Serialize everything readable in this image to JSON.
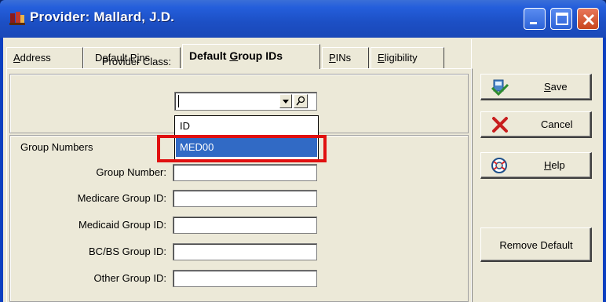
{
  "window": {
    "title": "Provider: Mallard, J.D."
  },
  "tabs": [
    {
      "label": "Address",
      "mnemonic": "A",
      "rest": "ddress"
    },
    {
      "label": "Default Pins",
      "pre": "Default P",
      "mnemonic": "i",
      "rest": "ns"
    },
    {
      "label": "Default Group IDs",
      "pre": "Default ",
      "mnemonic": "G",
      "rest": "roup IDs"
    },
    {
      "label": "PINs",
      "mnemonic": "P",
      "rest": "INs"
    },
    {
      "label": "Eligibility",
      "mnemonic": "E",
      "rest": "ligibility"
    }
  ],
  "provider_class": {
    "label": "Provider Class:",
    "value": ""
  },
  "dropdown": {
    "options": [
      "ID",
      "MED00"
    ],
    "selected": "MED00"
  },
  "group_numbers": {
    "heading": "Group Numbers",
    "fields": [
      {
        "label": "Group Number:",
        "value": ""
      },
      {
        "label": "Medicare Group ID:",
        "value": ""
      },
      {
        "label": "Medicaid Group ID:",
        "value": ""
      },
      {
        "label": "BC/BS Group ID:",
        "value": ""
      },
      {
        "label": "Other Group ID:",
        "value": ""
      }
    ]
  },
  "buttons": {
    "save": {
      "mnemonic": "S",
      "rest": "ave"
    },
    "cancel": {
      "label": "Cancel"
    },
    "help": {
      "mnemonic": "H",
      "rest": "elp"
    },
    "remove_default": {
      "label": "Remove Default"
    }
  },
  "icons": {
    "app": "app-icon",
    "save": "save-icon",
    "cancel": "cancel-icon",
    "help": "help-icon",
    "lookup": "lookup-icon",
    "dropdown": "chevron-down-icon"
  },
  "colors": {
    "titlebar": "#245edb",
    "selection": "#316ac5",
    "highlight": "#e01010",
    "face": "#ece9d8"
  }
}
